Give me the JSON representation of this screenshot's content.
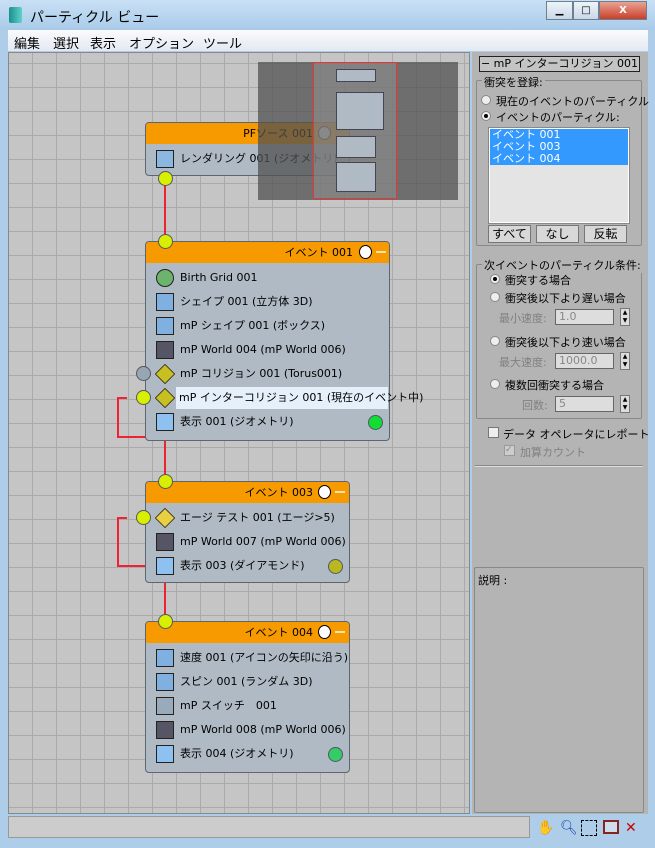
{
  "window": {
    "title": "パーティクル ビュー",
    "minimize": "▁",
    "maximize": "□",
    "close": "X"
  },
  "menu": [
    "編集",
    "選択",
    "表示",
    "オプション",
    "ツール"
  ],
  "nodes": {
    "source": {
      "title": "PFソース 001",
      "items": [
        {
          "label": "レンダリング 001 (ジオメトリ)",
          "icon": "teapot-icon"
        }
      ]
    },
    "event001": {
      "title": "イベント 001",
      "items": [
        {
          "label": "Birth Grid 001",
          "icon": "birth-grid-icon"
        },
        {
          "label": "シェイプ 001 (立方体 3D)",
          "icon": "shape-icon"
        },
        {
          "label": "mP シェイプ 001 (ボックス)",
          "icon": "mp-shape-icon"
        },
        {
          "label": "mP World 004 (mP World 006)",
          "icon": "mp-world-icon"
        },
        {
          "label": "mP コリジョン 001 (Torus001)",
          "icon": "mp-collision-icon"
        },
        {
          "label": "mP インターコリジョン 001 (現在のイベント中)",
          "icon": "mp-intercollision-icon"
        },
        {
          "label": "表示 001 (ジオメトリ)",
          "icon": "display-icon"
        }
      ]
    },
    "event003": {
      "title": "イベント 003",
      "items": [
        {
          "label": "エージ テスト 001 (エージ>5)",
          "icon": "age-test-icon"
        },
        {
          "label": "mP World 007 (mP World 006)",
          "icon": "mp-world-icon"
        },
        {
          "label": "表示 003 (ダイアモンド)",
          "icon": "display-icon"
        }
      ]
    },
    "event004": {
      "title": "イベント 004",
      "items": [
        {
          "label": "速度 001 (アイコンの矢印に沿う)",
          "icon": "speed-icon"
        },
        {
          "label": "スピン 001 (ランダム 3D)",
          "icon": "spin-icon"
        },
        {
          "label": "mP スイッチ　001",
          "icon": "mp-switch-icon"
        },
        {
          "label": "mP World 008 (mP World 006)",
          "icon": "mp-world-icon"
        },
        {
          "label": "表示 004 (ジオメトリ)",
          "icon": "display-icon"
        }
      ]
    }
  },
  "panel": {
    "rollout_title": "−  mP インターコリジョン 001",
    "register_group": "衝突を登録:",
    "radio_current": "現在のイベントのパーティクル",
    "radio_events": "イベントのパーティクル:",
    "event_list": [
      "イベント 001",
      "イベント 003",
      "イベント 004"
    ],
    "btn_all": "すべて",
    "btn_none": "なし",
    "btn_invert": "反転",
    "next_group": "次イベントのパーティクル条件:",
    "opt_collide": "衝突する場合",
    "opt_slower": "衝突後以下より遅い場合",
    "min_speed_label": "最小速度:",
    "min_speed": "1.0",
    "opt_faster": "衝突後以下より速い場合",
    "max_speed_label": "最大速度:",
    "max_speed": "1000.0",
    "opt_multiple": "複数回衝突する場合",
    "count_label": "回数:",
    "count": "5",
    "report_label": "データ オペレータにレポート",
    "additive_label": "加算カウント",
    "description_label": "説明 :"
  },
  "colors": {
    "event_header": "#f79a00",
    "selection": "#3399ff",
    "wire": "#e22233"
  }
}
